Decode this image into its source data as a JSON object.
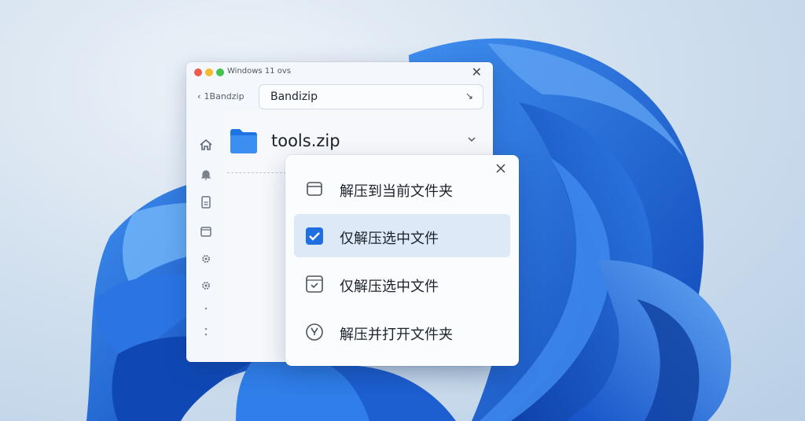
{
  "window": {
    "title": "Windows 11 ovs",
    "back_label": "1Bandzip",
    "path_value": "Bandizip"
  },
  "sidebar": {
    "icons": [
      "home-icon",
      "bell-icon",
      "document-icon",
      "archive-icon",
      "gear-icon",
      "gear-icon",
      "dot-icon",
      "more-icon"
    ]
  },
  "file": {
    "name": "tools.zip",
    "icon": "folder-icon"
  },
  "menu": {
    "items": [
      {
        "label": "解压到当前文件夹",
        "icon": "archive-box-icon",
        "selected": false
      },
      {
        "label": "仅解压选中文件",
        "icon": "checkbox-checked-icon",
        "selected": true
      },
      {
        "label": "仅解压选中文件",
        "icon": "box-check-icon",
        "selected": false
      },
      {
        "label": "解压并打开文件夹",
        "icon": "clock-arrow-icon",
        "selected": false
      }
    ]
  },
  "colors": {
    "accent": "#1f6fe0",
    "selected_bg": "#dde9f7",
    "wallpaper_blue": "#1b5fd6"
  }
}
